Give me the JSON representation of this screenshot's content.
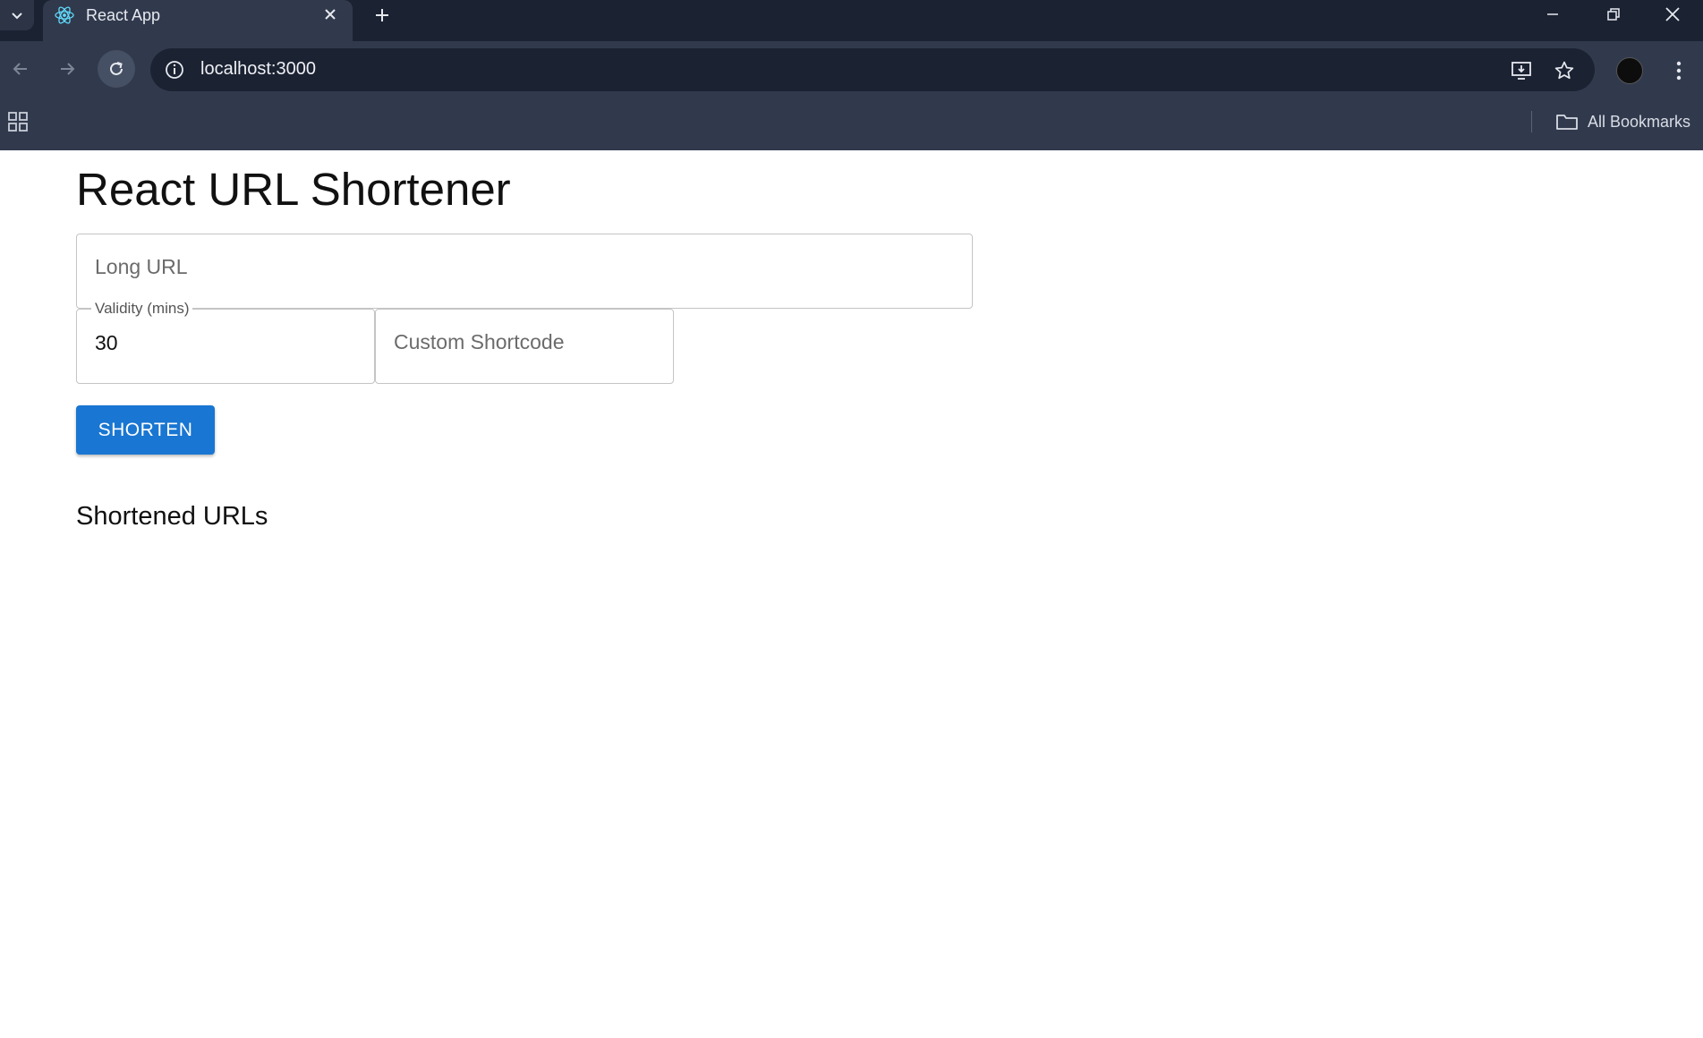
{
  "browser": {
    "tab": {
      "title": "React App"
    },
    "address_bar": {
      "url": "localhost:3000"
    },
    "bookmarks": {
      "all_bookmarks_label": "All Bookmarks"
    }
  },
  "app": {
    "title": "React URL Shortener",
    "form": {
      "long_url": {
        "placeholder": "Long URL",
        "value": ""
      },
      "validity": {
        "label": "Validity (mins)",
        "value": "30"
      },
      "custom_shortcode": {
        "placeholder": "Custom Shortcode",
        "value": ""
      },
      "submit_label": "SHORTEN"
    },
    "results": {
      "heading": "Shortened URLs",
      "items": []
    }
  },
  "colors": {
    "chrome_dark": "#1b2232",
    "chrome_mid": "#313a4d",
    "primary_button": "#1976d2",
    "field_border": "#c4c4c4"
  }
}
